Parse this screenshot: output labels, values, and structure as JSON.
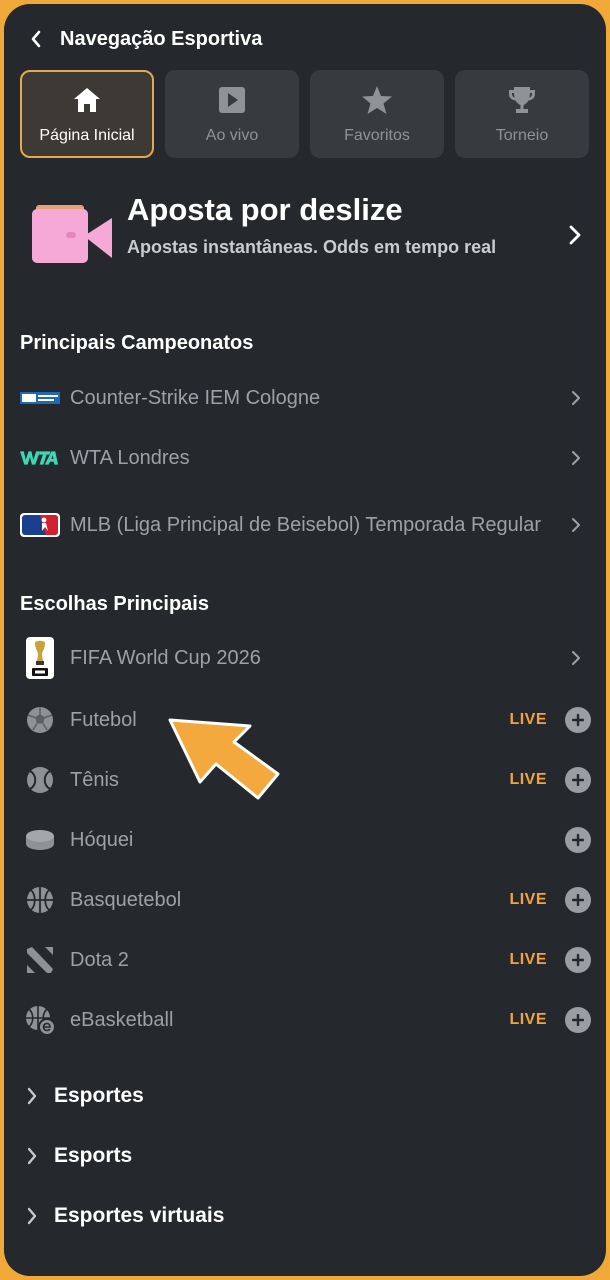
{
  "header": {
    "title": "Navegação Esportiva"
  },
  "tabs": [
    {
      "label": "Página Inicial",
      "icon": "home-icon",
      "active": true
    },
    {
      "label": "Ao vivo",
      "icon": "play-icon",
      "active": false
    },
    {
      "label": "Favoritos",
      "icon": "star-icon",
      "active": false
    },
    {
      "label": "Torneio",
      "icon": "trophy-icon",
      "active": false
    }
  ],
  "promo": {
    "title": "Aposta por deslize",
    "subtitle": "Apostas instantâneas. Odds em tempo real"
  },
  "top_leagues": {
    "title": "Principais Campeonatos",
    "items": [
      {
        "name": "Counter-Strike IEM Cologne",
        "icon": "intel-extreme-masters-logo"
      },
      {
        "name": "WTA Londres",
        "icon": "wta-logo"
      },
      {
        "name": "MLB (Liga Principal de Beisebol) Temporada Regular",
        "icon": "mlb-logo"
      }
    ]
  },
  "top_picks": {
    "title": "Escolhas Principais",
    "items": [
      {
        "name": "FIFA World Cup 2026",
        "icon": "fifa-world-cup-logo",
        "type": "chevron"
      },
      {
        "name": "Futebol",
        "icon": "soccer-ball-icon",
        "live": "LIVE"
      },
      {
        "name": "Tênis",
        "icon": "tennis-ball-icon",
        "live": "LIVE"
      },
      {
        "name": "Hóquei",
        "icon": "hockey-puck-icon",
        "live": ""
      },
      {
        "name": "Basquetebol",
        "icon": "basketball-icon",
        "live": "LIVE"
      },
      {
        "name": "Dota 2",
        "icon": "dota-icon",
        "live": "LIVE"
      },
      {
        "name": "eBasketball",
        "icon": "ebasketball-icon",
        "live": "LIVE"
      }
    ]
  },
  "categories": [
    {
      "label": "Esportes"
    },
    {
      "label": "Esports"
    },
    {
      "label": "Esportes virtuais"
    }
  ],
  "colors": {
    "background": "#25282c",
    "accent": "#f2a43a",
    "frame": "#f0a838",
    "promo_icon": "#f6a8d6"
  }
}
